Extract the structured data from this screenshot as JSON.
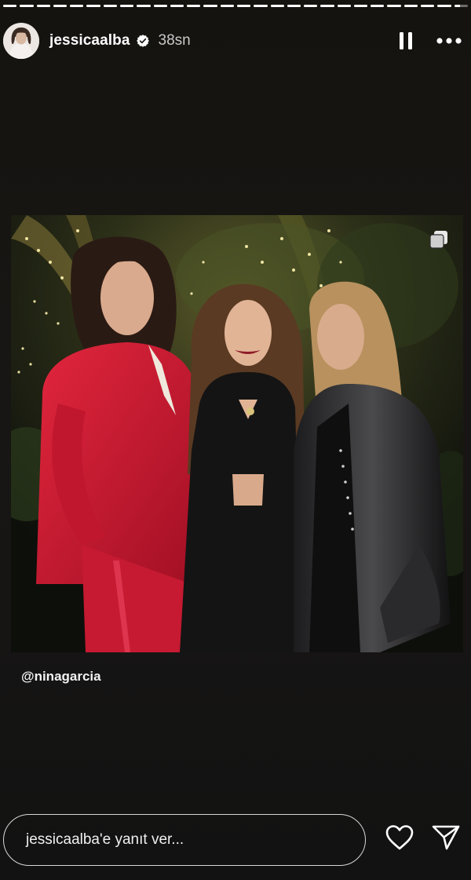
{
  "story": {
    "progress_segments": [
      1,
      1,
      1,
      1,
      1,
      1,
      1,
      1,
      1,
      1,
      1,
      1,
      1,
      1,
      1,
      1,
      1,
      1,
      1,
      1,
      1,
      1,
      1,
      1,
      1,
      1,
      1,
      0.4
    ],
    "colors": {
      "background": "#151413",
      "text": "#ffffff",
      "muted": "#c9c9c9"
    }
  },
  "header": {
    "username": "jessicaalba",
    "verified_icon": "verified-badge-icon",
    "time": "38sn",
    "pause_icon": "pause-icon",
    "more_icon": "more-options-icon"
  },
  "media": {
    "multi_icon": "carousel-icon",
    "caption": "@ninagarcia"
  },
  "reply": {
    "placeholder": "jessicaalba'e yanıt ver...",
    "like_icon": "heart-icon",
    "send_icon": "send-icon"
  }
}
